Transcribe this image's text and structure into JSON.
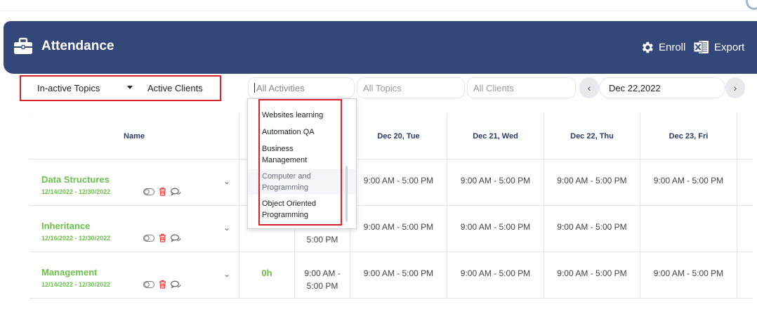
{
  "header": {
    "title": "Attendance",
    "enroll_label": "Enroll",
    "export_label": "Export"
  },
  "filters": {
    "topics_filter": "In-active Topics",
    "clients_filter": "Active Clients",
    "activities_placeholder": "All Activities",
    "topics_placeholder": "All Topics",
    "clients_placeholder": "All Clients",
    "date_value": "Dec 22,2022"
  },
  "dropdown": {
    "items": [
      "Websites learning",
      "Automation QA",
      "Business Management",
      "Computer and Programming",
      "Object Oriented Programming"
    ],
    "highlighted_index": 3
  },
  "table": {
    "name_header": "Name",
    "day_headers": [
      "Dec 20, Tue",
      "Dec 21, Wed",
      "Dec 22, Thu",
      "Dec 23, Fri"
    ],
    "rows": [
      {
        "name": "Data Structures",
        "dates": "12/14/2022 - 12/30/2022",
        "hours": "",
        "col_prev": "",
        "times": [
          "9:00 AM - 5:00 PM",
          "9:00 AM - 5:00 PM",
          "9:00 AM - 5:00 PM",
          "9:00 AM - 5:00 PM"
        ]
      },
      {
        "name": "Inheritance",
        "dates": "12/16/2022 - 12/30/2022",
        "hours": "",
        "col_prev": "5:00 PM",
        "times": [
          "9:00 AM - 5:00 PM",
          "9:00 AM - 5:00 PM",
          "9:00 AM - 5:00 PM",
          ""
        ]
      },
      {
        "name": "Management",
        "dates": "12/14/2022 - 12/30/2022",
        "hours": "0h",
        "col_prev": "9:00 AM - 5:00 PM",
        "times": [
          "9:00 AM - 5:00 PM",
          "9:00 AM - 5:00 PM",
          "9:00 AM - 5:00 PM",
          "9:00 AM - 5:00 PM"
        ]
      }
    ]
  },
  "colors": {
    "header_bg": "#344779",
    "accent_green": "#6bc04b",
    "highlight_red": "#d9232c"
  }
}
